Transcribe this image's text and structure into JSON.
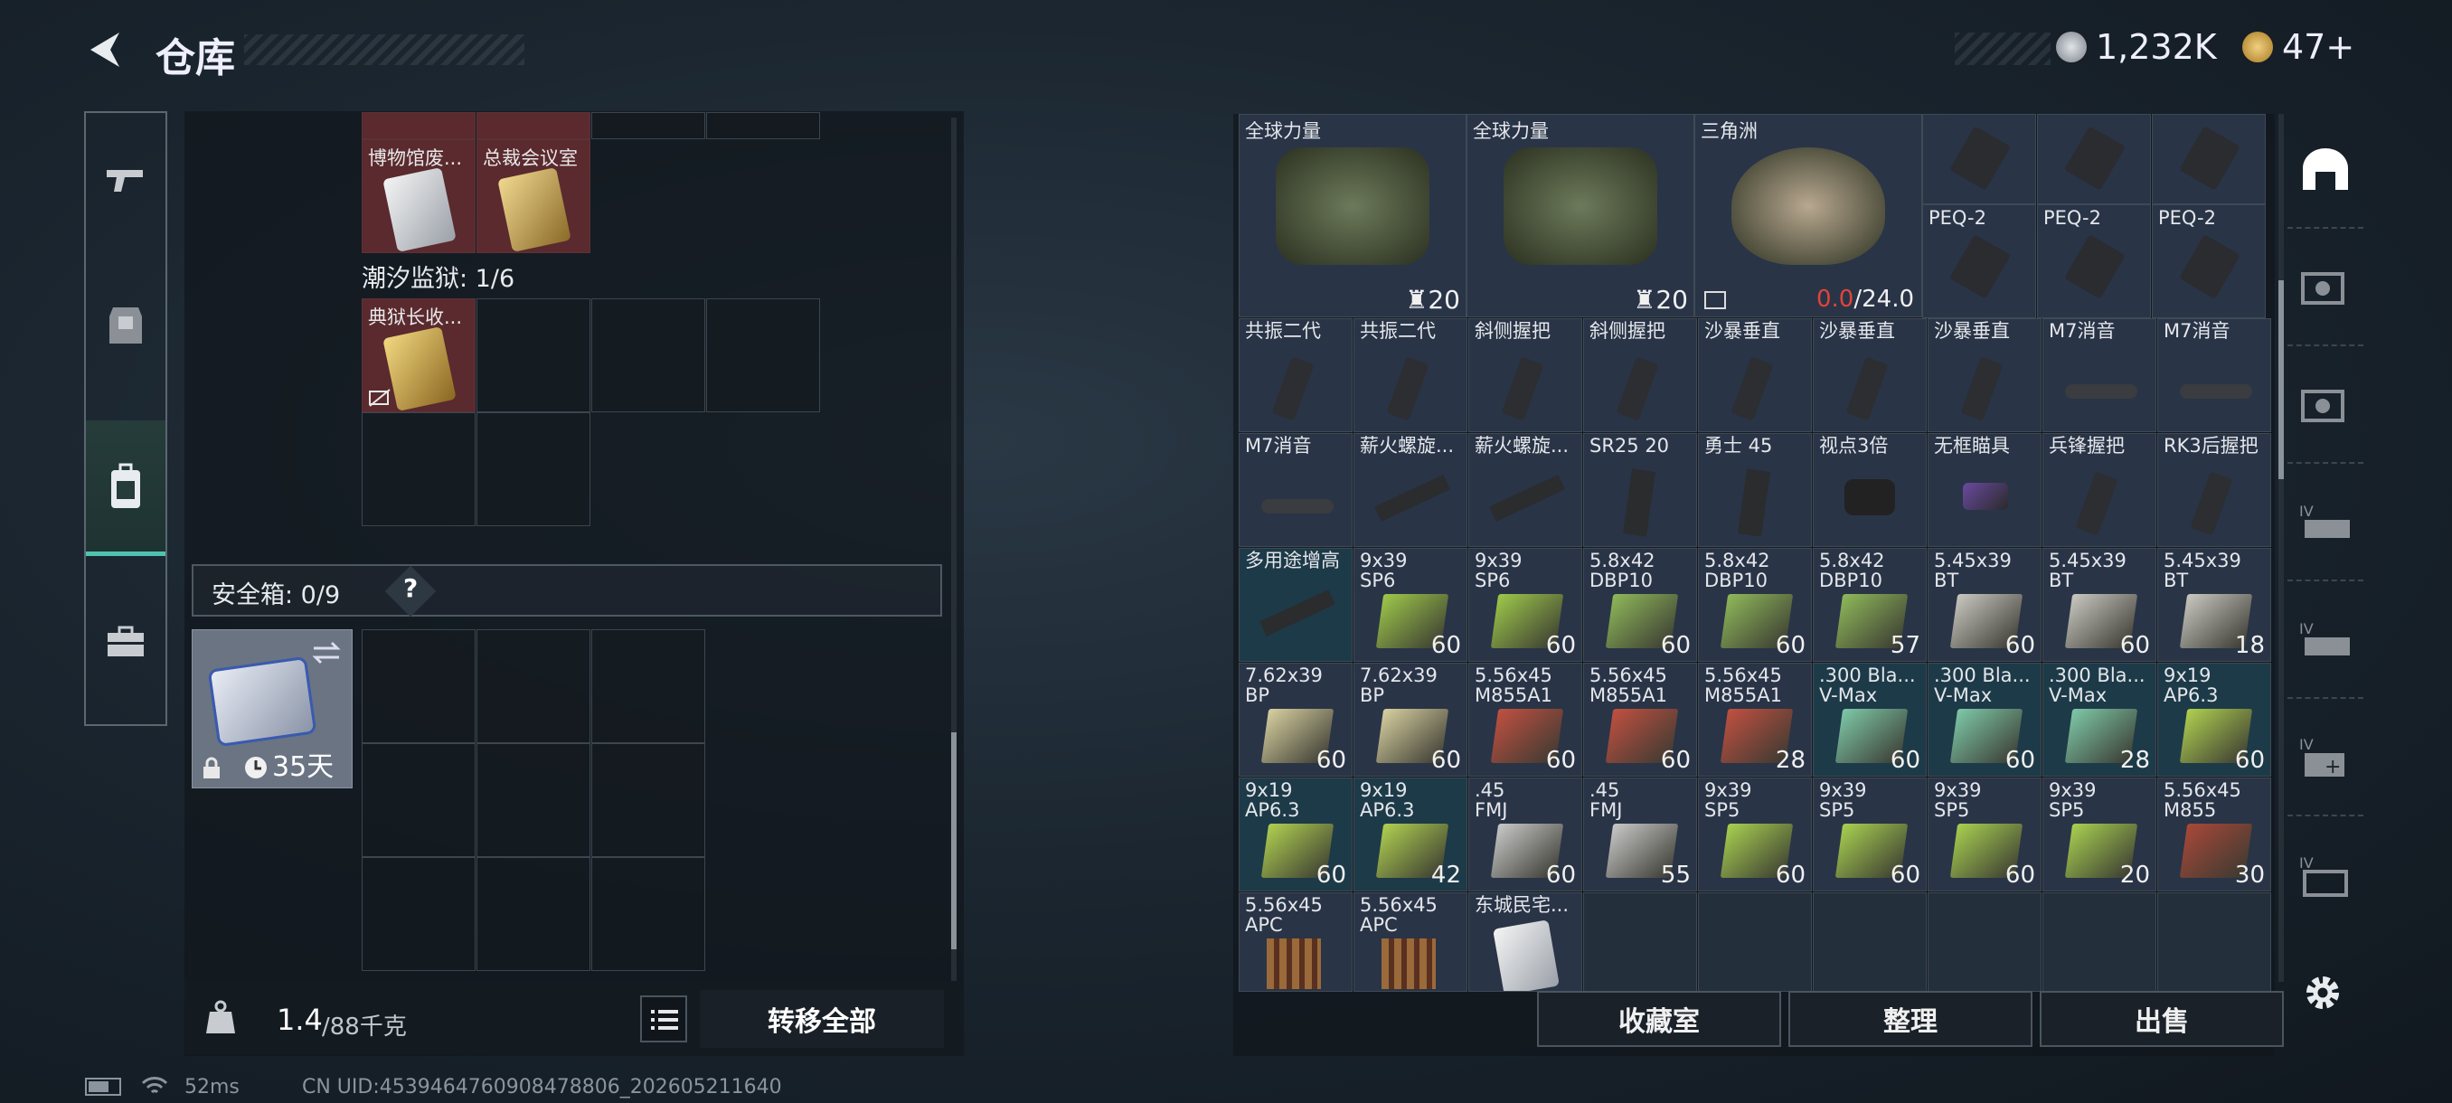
{
  "header": {
    "title": "仓库",
    "currency1": "1,232K",
    "currency2": "47+",
    "colors": {
      "currency1": "#b8bec4",
      "currency2": "#d6a93b"
    }
  },
  "left_tabs": [
    "gun-icon",
    "armor-icon",
    "backpack-icon",
    "case-icon"
  ],
  "left": {
    "top_items": [
      {
        "name": "博物馆废...",
        "card_color": "#e8e8e8"
      },
      {
        "name": "总裁会议室",
        "card_color": "#d8b05a"
      }
    ],
    "prison_label": "潮汐监狱: 1/6",
    "prison_item": {
      "name": "典狱长收...",
      "card_color": "#d9b45a"
    },
    "safe_label": "安全箱: 0/9",
    "help": "?",
    "safe_timer": "35天",
    "weight_value": "1.4",
    "weight_max": "/88千克",
    "transfer_all": "转移全部"
  },
  "right": {
    "big_items": [
      {
        "name": "全球力量",
        "count": "20"
      },
      {
        "name": "全球力量",
        "count": "20"
      },
      {
        "name": "三角洲",
        "durability_current": "0.0",
        "durability_max": "/24.0"
      }
    ],
    "peq_items": [
      {
        "name": "",
        "count": ""
      },
      {
        "name": "",
        "count": ""
      },
      {
        "name": "",
        "count": ""
      },
      {
        "name": "PEQ-2",
        "count": ""
      },
      {
        "name": "PEQ-2",
        "count": ""
      },
      {
        "name": "PEQ-2",
        "count": ""
      }
    ],
    "rows": [
      [
        {
          "name": "共振二代",
          "count": "",
          "kind": "grip"
        },
        {
          "name": "共振二代",
          "count": "",
          "kind": "grip"
        },
        {
          "name": "斜侧握把",
          "count": "",
          "kind": "grip"
        },
        {
          "name": "斜侧握把",
          "count": "",
          "kind": "grip"
        },
        {
          "name": "沙暴垂直",
          "count": "",
          "kind": "grip"
        },
        {
          "name": "沙暴垂直",
          "count": "",
          "kind": "grip"
        },
        {
          "name": "沙暴垂直",
          "count": "",
          "kind": "grip"
        },
        {
          "name": "M7消音",
          "count": "",
          "kind": "tube"
        },
        {
          "name": "M7消音",
          "count": "",
          "kind": "tube"
        }
      ],
      [
        {
          "name": "M7消音",
          "count": "",
          "kind": "tube"
        },
        {
          "name": "薪火螺旋...",
          "count": "",
          "kind": "rail"
        },
        {
          "name": "薪火螺旋...",
          "count": "",
          "kind": "rail"
        },
        {
          "name": "SR25 20",
          "count": "",
          "kind": "mag"
        },
        {
          "name": "勇士 45",
          "count": "",
          "kind": "mag"
        },
        {
          "name": "视点3倍",
          "count": "",
          "kind": "scope"
        },
        {
          "name": "无框瞄具",
          "count": "",
          "kind": "sight"
        },
        {
          "name": "兵锋握把",
          "count": "",
          "kind": "grip"
        },
        {
          "name": "RK3后握把",
          "count": "",
          "kind": "grip"
        }
      ],
      [
        {
          "name": "多用途增高",
          "count": "",
          "kind": "rail",
          "teal": true
        },
        {
          "name": "9x39\nSP6",
          "count": "60",
          "kind": "box",
          "color": "#9ec84a"
        },
        {
          "name": "9x39\nSP6",
          "count": "60",
          "kind": "box",
          "color": "#9ec84a"
        },
        {
          "name": "5.8x42\nDBP10",
          "count": "60",
          "kind": "box",
          "color": "#8fb85a"
        },
        {
          "name": "5.8x42\nDBP10",
          "count": "60",
          "kind": "box",
          "color": "#8fb85a"
        },
        {
          "name": "5.8x42\nDBP10",
          "count": "57",
          "kind": "box",
          "color": "#8fb85a"
        },
        {
          "name": "5.45x39\nBT",
          "count": "60",
          "kind": "box",
          "color": "#c8c8c0"
        },
        {
          "name": "5.45x39\nBT",
          "count": "60",
          "kind": "box",
          "color": "#c8c8c0"
        },
        {
          "name": "5.45x39\nBT",
          "count": "18",
          "kind": "box",
          "color": "#c8c8c0"
        }
      ],
      [
        {
          "name": "7.62x39\nBP",
          "count": "60",
          "kind": "box",
          "color": "#d8d0a0"
        },
        {
          "name": "7.62x39\nBP",
          "count": "60",
          "kind": "box",
          "color": "#d8d0a0"
        },
        {
          "name": "5.56x45\nM855A1",
          "count": "60",
          "kind": "box",
          "color": "#c05040"
        },
        {
          "name": "5.56x45\nM855A1",
          "count": "60",
          "kind": "box",
          "color": "#c05040"
        },
        {
          "name": "5.56x45\nM855A1",
          "count": "28",
          "kind": "box",
          "color": "#c05040"
        },
        {
          "name": ".300 Bla...\nV-Max",
          "count": "60",
          "kind": "box",
          "color": "#7ec8a8",
          "teal": true
        },
        {
          "name": ".300 Bla...\nV-Max",
          "count": "60",
          "kind": "box",
          "color": "#7ec8a8",
          "teal": true
        },
        {
          "name": ".300 Bla...\nV-Max",
          "count": "28",
          "kind": "box",
          "color": "#7ec8a8",
          "teal": true
        },
        {
          "name": "9x19\nAP6.3",
          "count": "60",
          "kind": "box",
          "color": "#b0d050",
          "teal": true
        }
      ],
      [
        {
          "name": "9x19\nAP6.3",
          "count": "60",
          "kind": "box",
          "color": "#b0d050",
          "teal": true
        },
        {
          "name": "9x19\nAP6.3",
          "count": "42",
          "kind": "box",
          "color": "#b0d050",
          "teal": true
        },
        {
          "name": ".45\nFMJ",
          "count": "60",
          "kind": "box",
          "color": "#c8c8c8"
        },
        {
          "name": ".45\nFMJ",
          "count": "55",
          "kind": "box",
          "color": "#c8c8c8"
        },
        {
          "name": "9x39\nSP5",
          "count": "60",
          "kind": "box",
          "color": "#a8d050"
        },
        {
          "name": "9x39\nSP5",
          "count": "60",
          "kind": "box",
          "color": "#a8d050"
        },
        {
          "name": "9x39\nSP5",
          "count": "60",
          "kind": "box",
          "color": "#a8d050"
        },
        {
          "name": "9x39\nSP5",
          "count": "20",
          "kind": "box",
          "color": "#a8d050"
        },
        {
          "name": "5.56x45\nM855",
          "count": "30",
          "kind": "box",
          "color": "#a84838"
        }
      ],
      [
        {
          "name": "5.56x45\nAPC",
          "count": "",
          "kind": "ammo",
          "color": "#9a6a3a"
        },
        {
          "name": "5.56x45\nAPC",
          "count": "",
          "kind": "ammo",
          "color": "#9a6a3a"
        },
        {
          "name": "东城民宅...",
          "count": "",
          "kind": "card",
          "color": "#e0e0e0"
        },
        {
          "name": "",
          "count": "",
          "kind": "empty"
        },
        {
          "name": "",
          "count": "",
          "kind": "empty"
        },
        {
          "name": "",
          "count": "",
          "kind": "empty"
        },
        {
          "name": "",
          "count": "",
          "kind": "empty"
        },
        {
          "name": "",
          "count": "",
          "kind": "empty"
        },
        {
          "name": "",
          "count": "",
          "kind": "empty"
        }
      ]
    ],
    "buttons": {
      "collection": "收藏室",
      "sort": "整理",
      "sell": "出售"
    }
  },
  "right_tabs": [
    "helmet-icon",
    "chest-rig-icon",
    "backpack-rig-icon",
    "tier-iv-armor-icon",
    "tier-iv-case-icon",
    "tier-iv-add-icon",
    "tier-iv-folder-icon",
    "settings-icon"
  ],
  "status": {
    "ping": "52ms",
    "uid": "CN UID:4539464760908478806_202605211640"
  }
}
